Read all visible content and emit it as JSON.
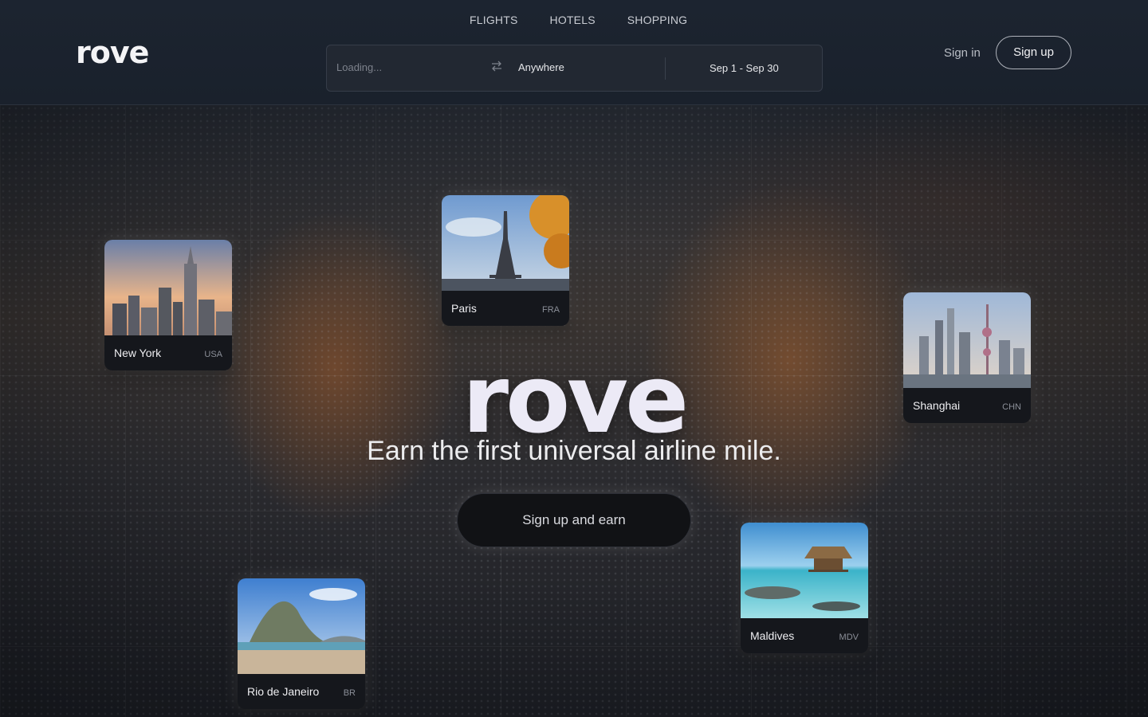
{
  "header": {
    "logo": "rove",
    "nav": [
      "FLIGHTS",
      "HOTELS",
      "SHOPPING"
    ],
    "search": {
      "from_placeholder": "Loading...",
      "to": "Anywhere",
      "dates": "Sep 1 - Sep 30"
    },
    "signin": "Sign in",
    "signup": "Sign up"
  },
  "hero": {
    "logo": "rove",
    "tagline": "Earn the first universal airline mile.",
    "cta": "Sign up and earn"
  },
  "cities": [
    {
      "name": "New York",
      "code": "USA"
    },
    {
      "name": "Paris",
      "code": "FRA"
    },
    {
      "name": "Shanghai",
      "code": "CHN"
    },
    {
      "name": "Maldives",
      "code": "MDV"
    },
    {
      "name": "Rio de Janeiro",
      "code": "BR"
    }
  ],
  "icons": {
    "swap": "swap-arrows-icon"
  }
}
